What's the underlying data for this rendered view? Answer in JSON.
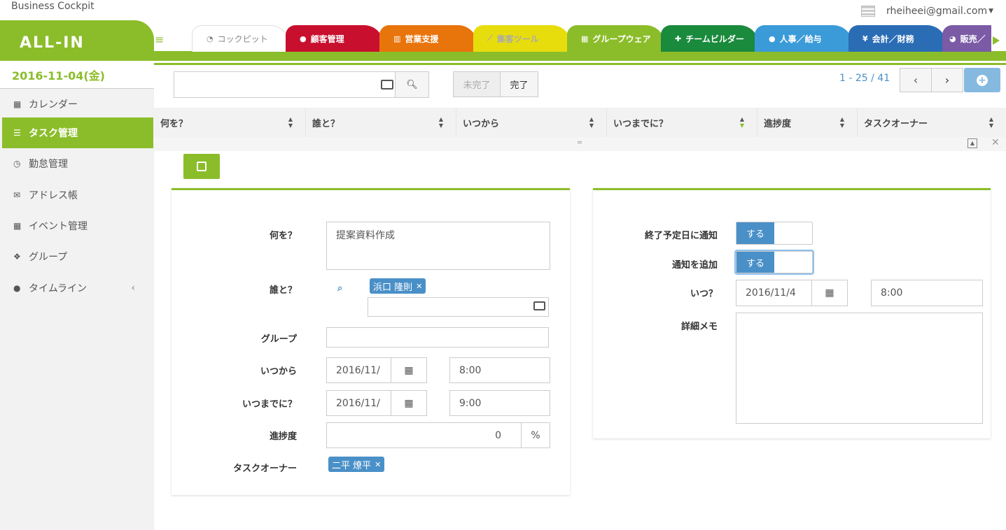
{
  "app": {
    "title": "Business Cockpit",
    "logo": "ALL-IN",
    "date": "2016-11-04(金)",
    "user": "rheiheei@gmail.com"
  },
  "tabs": [
    {
      "label": "コックピット",
      "icon": "gauge-icon",
      "color": "#ffffff"
    },
    {
      "label": "顧客管理",
      "icon": "comments-icon",
      "color": "#c8102e"
    },
    {
      "label": "営業支援",
      "icon": "bar-chart-icon",
      "color": "#e8740c"
    },
    {
      "label": "集客ツール",
      "icon": "line-chart-icon",
      "color": "#e8dd0c"
    },
    {
      "label": "グループウェア",
      "icon": "calendar-icon",
      "color": "#8bbd2a"
    },
    {
      "label": "チームビルダー",
      "icon": "user-plus-icon",
      "color": "#1a8a3c"
    },
    {
      "label": "人事／給与",
      "icon": "users-icon",
      "color": "#3a9bd8"
    },
    {
      "label": "会計／財務",
      "icon": "yen-icon",
      "color": "#2a6db5"
    },
    {
      "label": "販売／",
      "icon": "pie-icon",
      "color": "#7b5aa6"
    }
  ],
  "sidebar": {
    "items": [
      {
        "label": "カレンダー",
        "icon": "calendar-icon"
      },
      {
        "label": "タスク管理",
        "icon": "tasks-icon"
      },
      {
        "label": "勤怠管理",
        "icon": "clock-icon"
      },
      {
        "label": "アドレス帳",
        "icon": "envelope-icon"
      },
      {
        "label": "イベント管理",
        "icon": "calendar-icon"
      },
      {
        "label": "グループ",
        "icon": "cubes-icon"
      },
      {
        "label": "タイムライン",
        "icon": "comments-icon"
      }
    ]
  },
  "toolbar": {
    "incomplete": "未完了",
    "complete": "完了",
    "pager": "1 - 25 / 41"
  },
  "grid": {
    "columns": [
      "何を？",
      "誰と？",
      "いつから",
      "いつまでに？",
      "進捗度",
      "タスクオーナー"
    ]
  },
  "form": {
    "what_label": "何を？",
    "what_value": "提案資料作成",
    "who_label": "誰と？",
    "who_tag": "浜口 隆則",
    "group_label": "グループ",
    "from_label": "いつから",
    "from_date": "2016/11/",
    "from_time": "8:00",
    "until_label": "いつまでに？",
    "until_date": "2016/11/",
    "until_time": "9:00",
    "progress_label": "進捗度",
    "progress_value": "0",
    "progress_unit": "%",
    "owner_label": "タスクオーナー",
    "owner_tag": "二平 燎平"
  },
  "notify": {
    "end_label": "終了予定日に通知",
    "end_toggle": "する",
    "add_label": "通知を追加",
    "add_toggle": "する",
    "when_label": "いつ？",
    "when_date": "2016/11/4",
    "when_time": "8:00",
    "memo_label": "詳細メモ"
  }
}
